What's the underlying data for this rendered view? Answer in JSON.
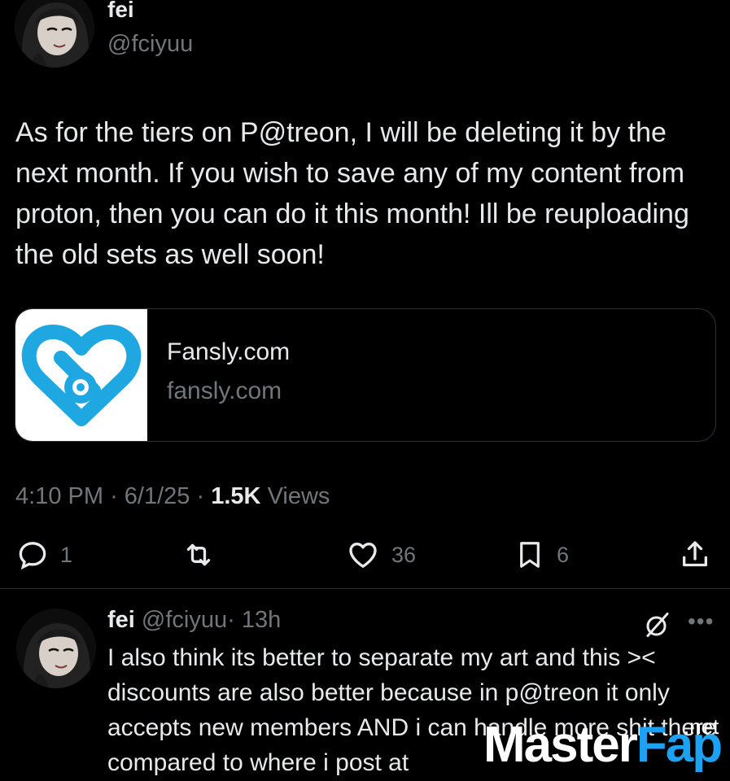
{
  "tweet": {
    "author_name": "fei",
    "author_handle": "@fciyuu",
    "text": "As for the tiers on P@treon, I will be deleting it by the next month. If you wish to save any of my content from proton, then you can do it this month! Ill  be reuploading the old sets as well soon!",
    "link_card": {
      "title": "Fansly.com",
      "domain": "fansly.com",
      "icon": "fansly-heart-logo"
    },
    "time": "4:10 PM",
    "date": "6/1/25",
    "views_count": "1.5K",
    "views_label": "Views",
    "separator": "·",
    "actions": {
      "reply_count": "1",
      "retweet_count": "",
      "like_count": "36",
      "bookmark_count": "6"
    }
  },
  "reply": {
    "author_name": "fei",
    "author_handle": "@fciyuu",
    "age": "· 13h",
    "text": "I also think its better to separate my art and this >< discounts are also better because in p@treon it only accepts new members AND i can handle more shit there compared to where i post at"
  },
  "watermark": {
    "part1": "Master",
    "part2": "Fap",
    "suffix": ".net"
  },
  "colors": {
    "background": "#000000",
    "text_primary": "#e7e9ea",
    "text_secondary": "#71767b",
    "fansly_blue": "#1fa7e2",
    "divider": "#2f3336"
  }
}
